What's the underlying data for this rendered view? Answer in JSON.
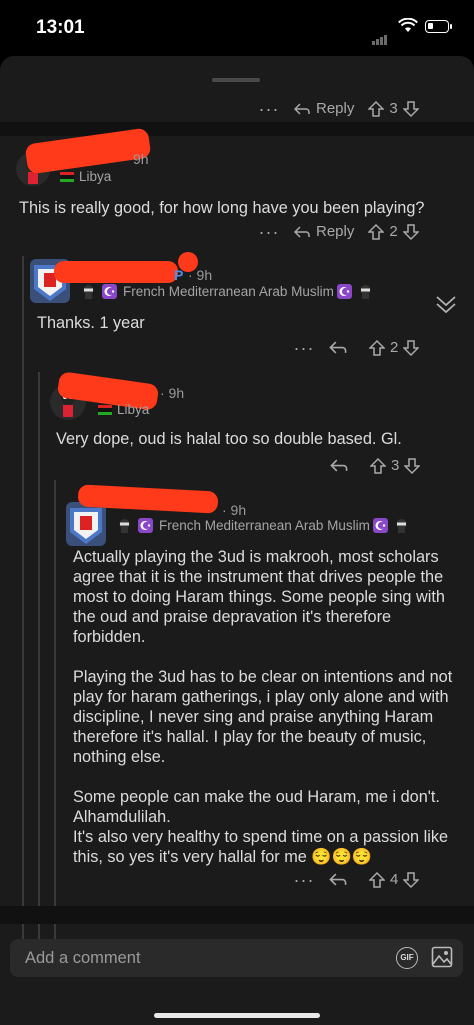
{
  "status_bar": {
    "time": "13:01"
  },
  "top_partial": {
    "reply": "Reply",
    "votes": "3"
  },
  "comments": [
    {
      "age": "9h",
      "flair": "Libya",
      "text": "This is really good, for how long have you been playing?",
      "reply": "Reply",
      "votes": "2"
    },
    {
      "age": "· 9h",
      "flair": "French Mediterranean Arab Muslim",
      "text": "Thanks. 1 year",
      "votes": "2"
    },
    {
      "age": "· 9h",
      "flair": "Libya",
      "text": "Very dope, oud is halal too so double based. Gl.",
      "votes": "3"
    },
    {
      "age": "· 9h",
      "flair": "French Mediterranean Arab Muslim",
      "paragraphs": [
        "Actually playing the 3ud is makrooh, most scholars agree that it is the instrument that drives people the most to doing Haram things. Some people sing with the oud and praise depravation it's therefore forbidden.",
        "Playing the 3ud has to be clear on intentions and not play for haram gatherings, i play only alone and with discipline, I never sing and praise anything Haram therefore it's hallal. I play for the beauty of music, nothing else.",
        "Some people can make the oud Haram, me i don't. Alhamdulilah.",
        "It's also very healthy to spend time on a passion like this, so yes it's very hallal for me 😌😌😌"
      ],
      "votes": "4"
    }
  ],
  "composer": {
    "placeholder": "Add a comment",
    "gif_label": "GIF"
  },
  "partial_name_letter": "P",
  "accent_color": "#ff3a1a"
}
